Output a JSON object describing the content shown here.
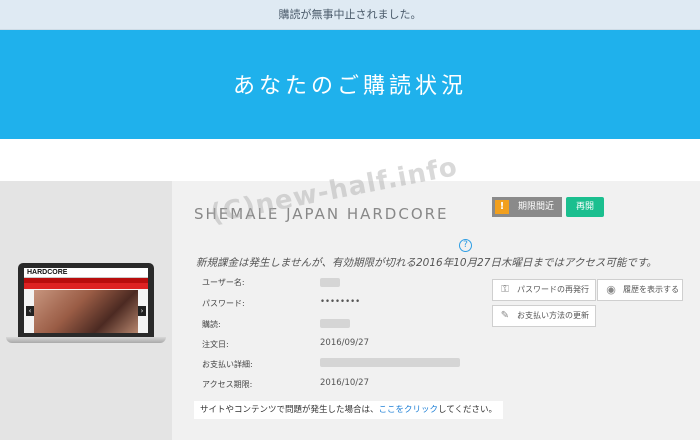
{
  "notice": {
    "text": "購読が無事中止されました。"
  },
  "hero": {
    "title": "あなたのご購読状況"
  },
  "subscription": {
    "product_name": "SHEMALE JAPAN HARDCORE",
    "status_badge": "期限間近",
    "renew_label": "再開",
    "help_icon": "?",
    "expiry_note": "新規課金は発生しませんが、有効期限が切れる2016年10月27日木曜日まではアクセス可能です。",
    "thumbnail": {
      "logo_text": "HARDCORE"
    },
    "details": [
      {
        "label": "ユーザー名:",
        "value": ""
      },
      {
        "label": "パスワード:",
        "value": "••••••••"
      },
      {
        "label": "購読:",
        "value": ""
      },
      {
        "label": "注文日:",
        "value": "2016/09/27"
      },
      {
        "label": "お支払い詳細:",
        "value": ""
      },
      {
        "label": "アクセス期限:",
        "value": "2016/10/27"
      }
    ],
    "actions": {
      "reissue_password": "パスワードの再発行",
      "show_history": "履歴を表示する",
      "update_payment": "お支払い方法の更新"
    },
    "help": {
      "prefix": "サイトやコンテンツで問題が発生した場合は、",
      "link": "ここをクリック",
      "suffix": "してください。"
    }
  },
  "watermark": "(C)new-half.info",
  "icons": {
    "warning": "warning-icon",
    "lock": "lock-icon",
    "eye": "eye-icon",
    "edit": "edit-icon",
    "help": "help-icon"
  },
  "colors": {
    "hero_bg": "#1fb1ec",
    "notice_bg": "#dfeaf3",
    "warn": "#f2a01e",
    "renew": "#1bbf8f",
    "link": "#1d7fd6"
  }
}
